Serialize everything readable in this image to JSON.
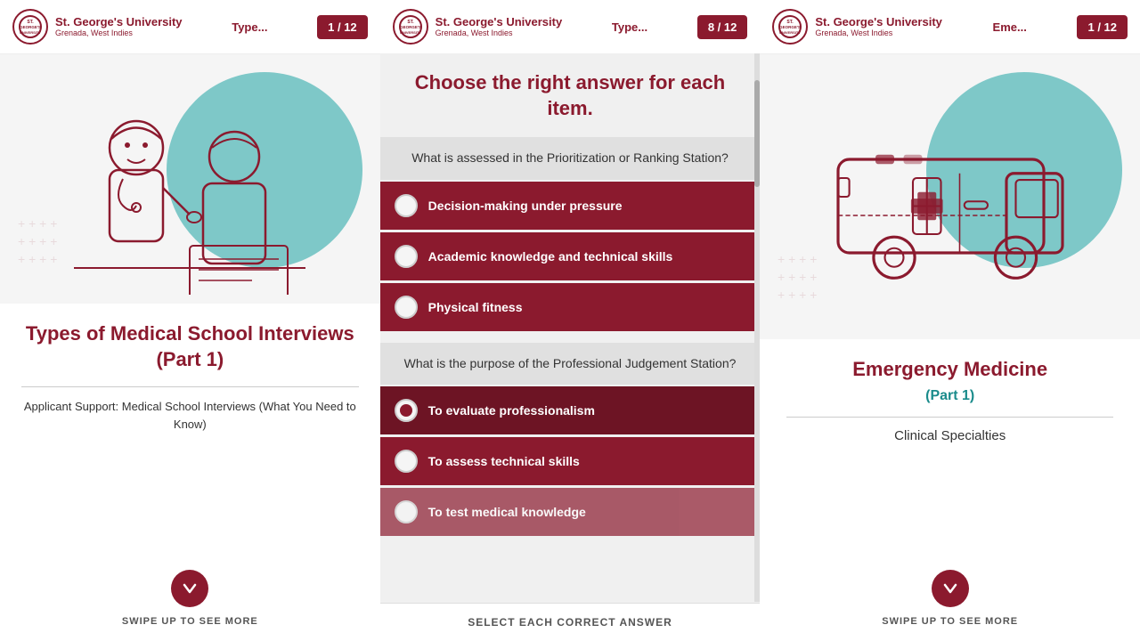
{
  "panels": {
    "left": {
      "header": {
        "university": "St. George's University",
        "location": "Grenada, West Indies",
        "tag": "Type...",
        "counter": "1 / 12"
      },
      "title": "Types of Medical School Interviews (Part 1)",
      "subtitle": "Applicant Support: Medical School Interviews (What You Need to Know)",
      "swipe_label": "SWIPE UP TO SEE MORE"
    },
    "middle": {
      "header": {
        "university": "St. George's University",
        "location": "Grenada, West Indies",
        "tag": "Type...",
        "counter": "8 / 12"
      },
      "quiz_title": "Choose the right answer for each item.",
      "questions": [
        {
          "text": "What is assessed in the Prioritization or Ranking Station?",
          "answers": [
            {
              "label": "Decision-making under pressure",
              "selected": false
            },
            {
              "label": "Academic knowledge and technical skills",
              "selected": false
            },
            {
              "label": "Physical fitness",
              "selected": false
            }
          ]
        },
        {
          "text": "What is the purpose of the Professional Judgement Station?",
          "answers": [
            {
              "label": "To evaluate professionalism",
              "selected": true
            },
            {
              "label": "To assess technical skills",
              "selected": false
            },
            {
              "label": "To test medical knowledge",
              "selected": false
            }
          ]
        }
      ],
      "bottom_label": "SELECT EACH CORRECT ANSWER"
    },
    "right": {
      "header": {
        "university": "St. George's University",
        "location": "Grenada, West Indies",
        "tag": "Eme...",
        "counter": "1 / 12"
      },
      "title": "Emergency Medicine",
      "part_label": "(Part 1)",
      "clinical": "Clinical Specialties",
      "swipe_label": "SWIPE UP TO SEE MORE"
    }
  }
}
